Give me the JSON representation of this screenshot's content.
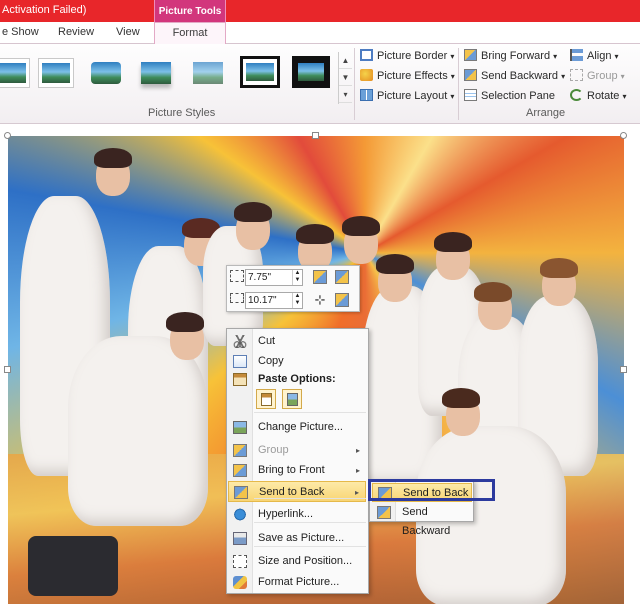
{
  "titlebar": {
    "title_fragment": "Activation Failed)",
    "context_tab_header": "Picture Tools"
  },
  "tabs": {
    "slideshow": "e Show",
    "review": "Review",
    "view": "View",
    "format": "Format"
  },
  "ribbon": {
    "picture_styles_label": "Picture Styles",
    "arrange_label": "Arrange",
    "picture_border": "Picture Border",
    "picture_effects": "Picture Effects",
    "picture_layout": "Picture Layout",
    "bring_forward": "Bring Forward",
    "send_backward": "Send Backward",
    "selection_pane": "Selection Pane",
    "align": "Align",
    "group": "Group",
    "rotate": "Rotate"
  },
  "mini_toolbar": {
    "height_value": "7.75\"",
    "width_value": "10.17\""
  },
  "context_menu": {
    "items": [
      {
        "label": "Cut",
        "icon": "scissors-icon",
        "enabled": true
      },
      {
        "label": "Copy",
        "icon": "copy-icon",
        "enabled": true
      },
      {
        "label": "Paste Options:",
        "icon": "clipboard-icon",
        "enabled": true
      },
      {
        "label": "Change Picture...",
        "icon": "picture-icon",
        "enabled": true
      },
      {
        "label": "Group",
        "icon": "group-icon",
        "enabled": false
      },
      {
        "label": "Bring to Front",
        "icon": "bring-front-icon",
        "enabled": true
      },
      {
        "label": "Send to Back",
        "icon": "send-back-icon",
        "enabled": true,
        "highlighted": true
      },
      {
        "label": "Hyperlink...",
        "icon": "hyperlink-icon",
        "enabled": true
      },
      {
        "label": "Save as Picture...",
        "icon": "save-icon",
        "enabled": true
      },
      {
        "label": "Size and Position...",
        "icon": "size-icon",
        "enabled": true
      },
      {
        "label": "Format Picture...",
        "icon": "format-icon",
        "enabled": true
      }
    ]
  },
  "submenu": {
    "items": [
      {
        "label": "Send to Back",
        "highlighted": true
      },
      {
        "label": "Send Backward",
        "highlighted": false
      }
    ]
  },
  "colors": {
    "title_bar": "#e8262a",
    "context_tab": "#d2367c",
    "highlight": "#f8d574",
    "outline": "#2c3a9e"
  }
}
